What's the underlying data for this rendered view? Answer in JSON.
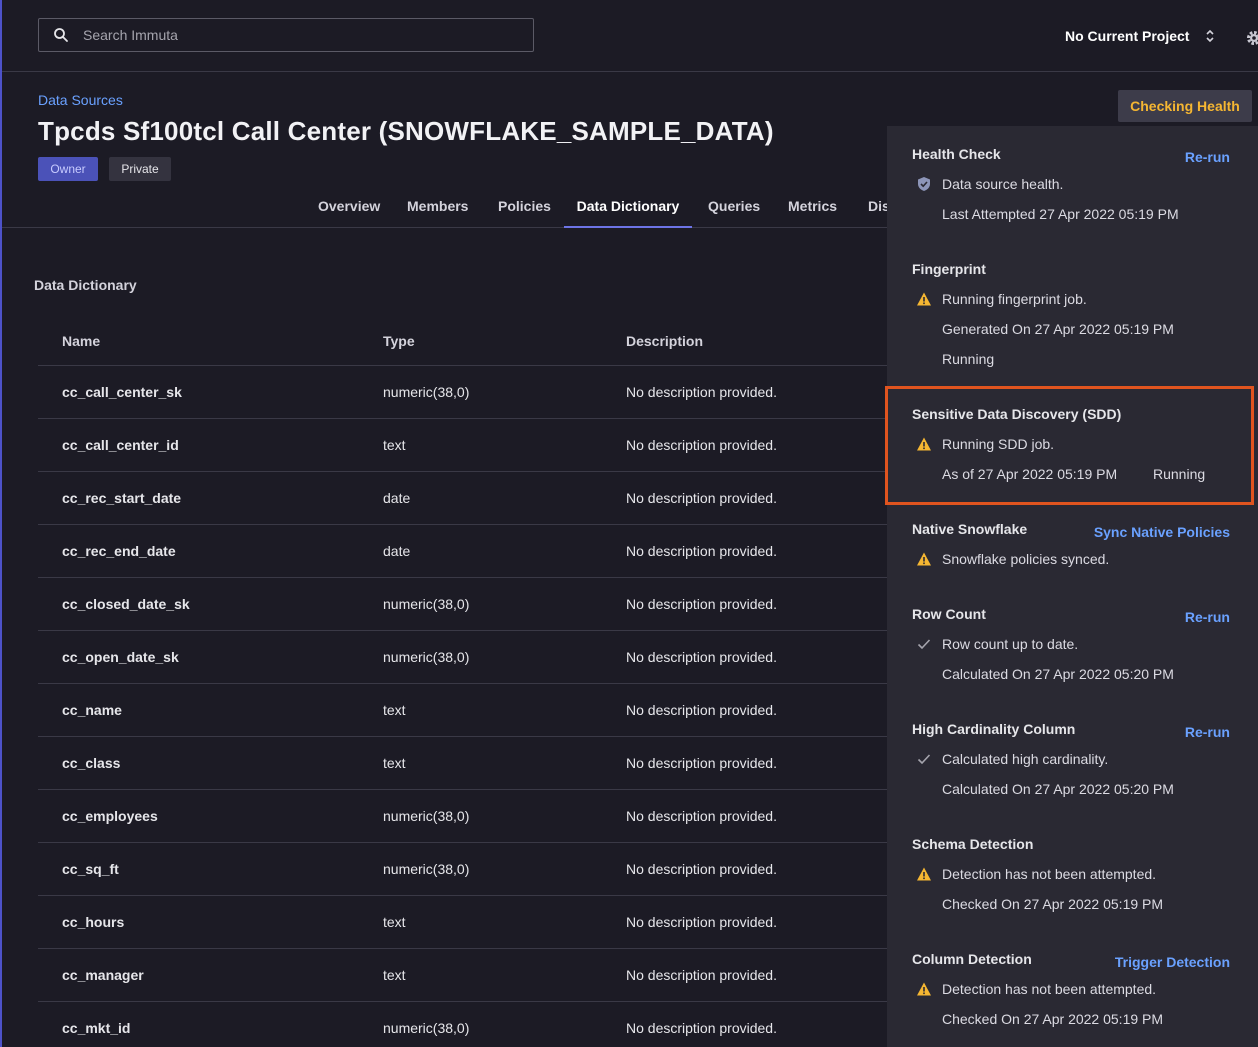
{
  "search": {
    "placeholder": "Search Immuta"
  },
  "project": {
    "label": "No Current Project"
  },
  "header": {
    "breadcrumb": "Data Sources",
    "title": "Tpcds Sf100tcl Call Center (SNOWFLAKE_SAMPLE_DATA)",
    "badges": [
      "Owner",
      "Private"
    ],
    "checking_health": "Checking Health"
  },
  "tabs": [
    "Overview",
    "Members",
    "Policies",
    "Data Dictionary",
    "Queries",
    "Metrics",
    "Dis"
  ],
  "active_tab": "Data Dictionary",
  "dictionary": {
    "title": "Data Dictionary",
    "columns": [
      "Name",
      "Type",
      "Description"
    ],
    "rows": [
      [
        "cc_call_center_sk",
        "numeric(38,0)",
        "No description provided."
      ],
      [
        "cc_call_center_id",
        "text",
        "No description provided."
      ],
      [
        "cc_rec_start_date",
        "date",
        "No description provided."
      ],
      [
        "cc_rec_end_date",
        "date",
        "No description provided."
      ],
      [
        "cc_closed_date_sk",
        "numeric(38,0)",
        "No description provided."
      ],
      [
        "cc_open_date_sk",
        "numeric(38,0)",
        "No description provided."
      ],
      [
        "cc_name",
        "text",
        "No description provided."
      ],
      [
        "cc_class",
        "text",
        "No description provided."
      ],
      [
        "cc_employees",
        "numeric(38,0)",
        "No description provided."
      ],
      [
        "cc_sq_ft",
        "numeric(38,0)",
        "No description provided."
      ],
      [
        "cc_hours",
        "text",
        "No description provided."
      ],
      [
        "cc_manager",
        "text",
        "No description provided."
      ],
      [
        "cc_mkt_id",
        "numeric(38,0)",
        "No description provided."
      ]
    ]
  },
  "health": {
    "health_check": {
      "title": "Health Check",
      "action": "Re-run",
      "status": "Data source health.",
      "detail": "Last Attempted 27 Apr 2022 05:19 PM",
      "icon": "shield-icon"
    },
    "fingerprint": {
      "title": "Fingerprint",
      "status": "Running fingerprint job.",
      "detail": "Generated On 27 Apr 2022 05:19 PM",
      "state": "Running",
      "icon": "warning-icon"
    },
    "sdd": {
      "title": "Sensitive Data Discovery (SDD)",
      "status": "Running SDD job.",
      "detail": "As of 27 Apr 2022 05:19 PM",
      "state": "Running",
      "icon": "warning-icon"
    },
    "native_snowflake": {
      "title": "Native Snowflake",
      "action": "Sync Native Policies",
      "status": "Snowflake policies synced.",
      "icon": "warning-icon"
    },
    "row_count": {
      "title": "Row Count",
      "action": "Re-run",
      "status": "Row count up to date.",
      "detail": "Calculated On 27 Apr 2022 05:20 PM",
      "icon": "check-icon"
    },
    "high_cardinality": {
      "title": "High Cardinality Column",
      "action": "Re-run",
      "status": "Calculated high cardinality.",
      "detail": "Calculated On 27 Apr 2022 05:20 PM",
      "icon": "check-icon"
    },
    "schema_detection": {
      "title": "Schema Detection",
      "status": "Detection has not been attempted.",
      "detail": "Checked On 27 Apr 2022 05:19 PM",
      "icon": "warning-icon"
    },
    "column_detection": {
      "title": "Column Detection",
      "action": "Trigger Detection",
      "status": "Detection has not been attempted.",
      "detail": "Checked On 27 Apr 2022 05:19 PM",
      "icon": "warning-icon"
    }
  },
  "colors": {
    "accent": "#6d74e6",
    "link": "#6aa1ff",
    "warning": "#f5b632",
    "highlight": "#e0541f"
  }
}
